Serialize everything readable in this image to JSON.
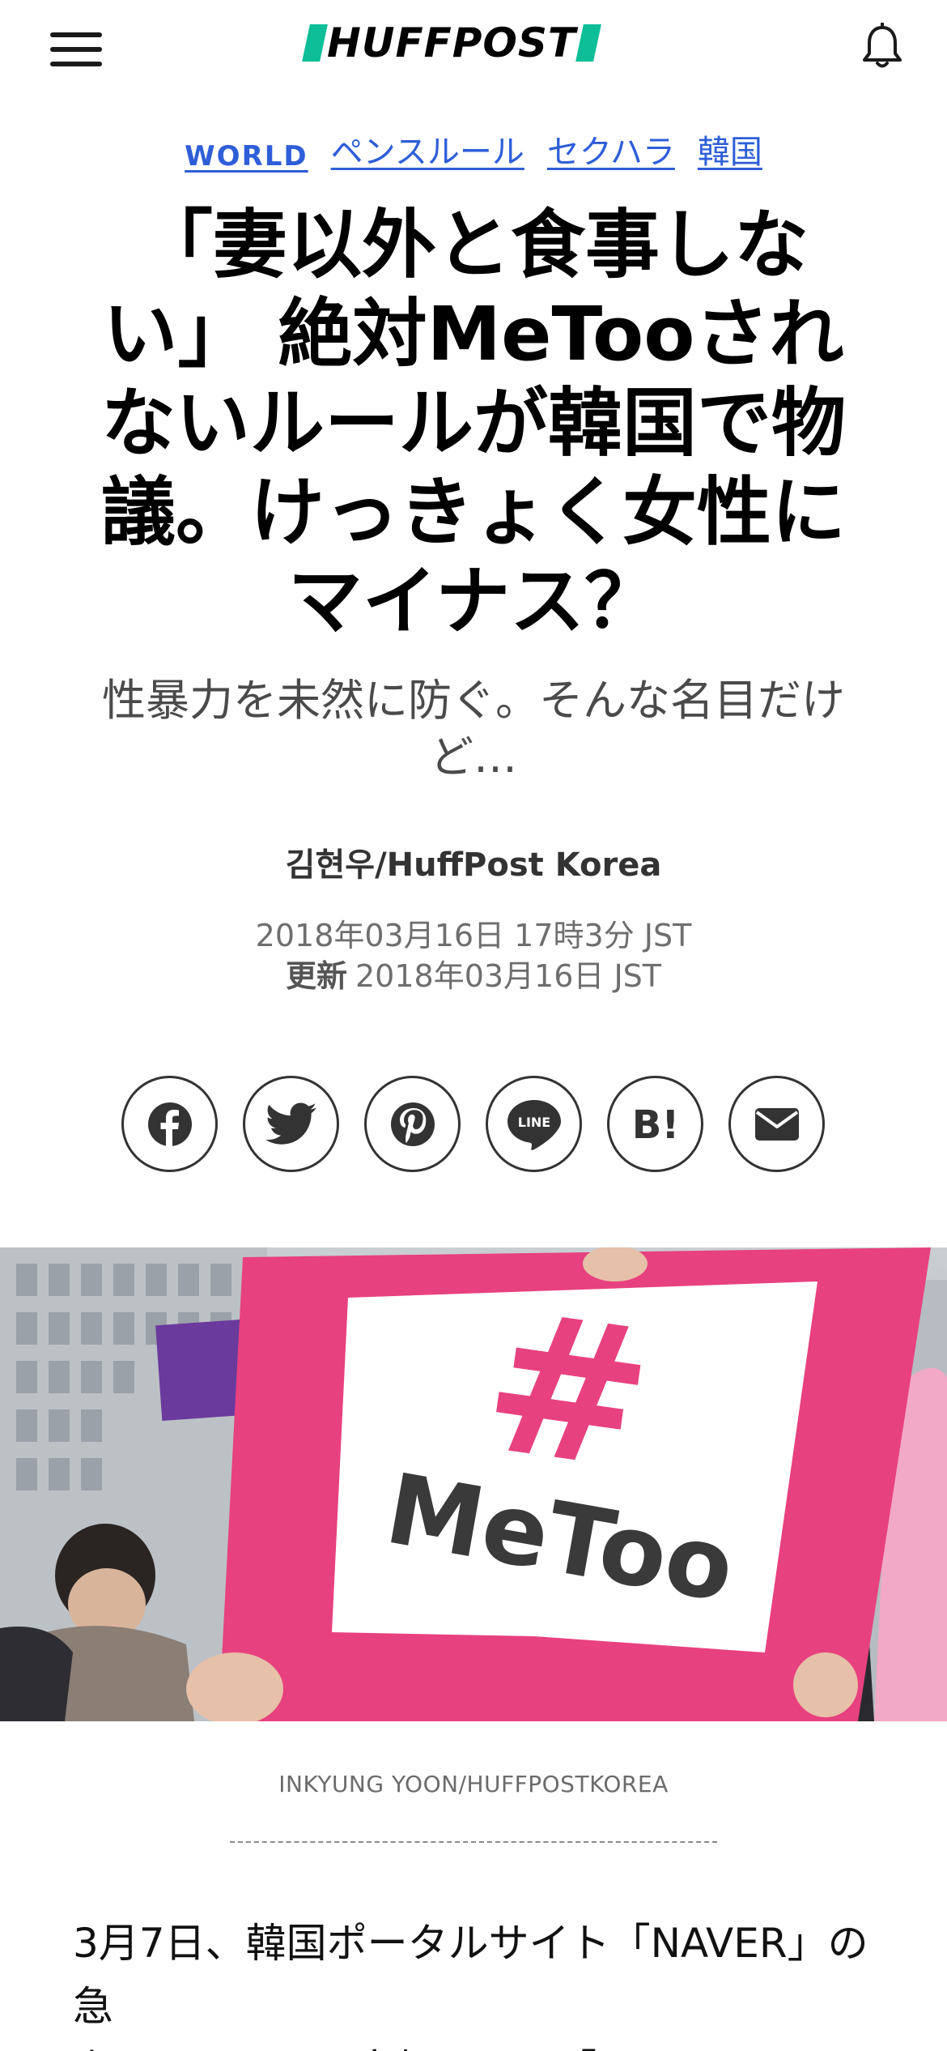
{
  "header": {
    "logo_text": "HUFFPOST",
    "menu_icon": "hamburger-menu-icon",
    "bell_icon": "bell-icon"
  },
  "tags": [
    "WORLD",
    "ペンスルール",
    "セクハラ",
    "韓国"
  ],
  "article": {
    "headline": "「妻以外と食事しない」 絶対MeTooされないルールが韓国で物議。けっきょく女性にマイナス？",
    "subhead": "性暴力を未然に防ぐ。そんな名目だけど…",
    "byline": "김현우/HuffPost Korea",
    "published": "2018年03月16日 17時3分 JST",
    "updated_label": "更新",
    "updated": "2018年03月16日 JST",
    "image_caption": "INKYUNG YOON/HUFFPOSTKOREA",
    "image_sign_hash": "#",
    "image_sign_text": "MeToo",
    "body_lines": [
      "3月7日、韓国ポータルサイト「NAVER」の急",
      "上昇ワードに、突如として「ペンスルール」"
    ]
  },
  "share": [
    {
      "icon": "facebook-icon"
    },
    {
      "icon": "twitter-icon"
    },
    {
      "icon": "pinterest-icon"
    },
    {
      "icon": "line-icon",
      "label": "LINE"
    },
    {
      "icon": "hatena-bookmark-icon",
      "label": "B!"
    },
    {
      "icon": "email-icon"
    }
  ],
  "colors": {
    "accent_link": "#2e5ed8",
    "logo_green": "#0dbe98",
    "sign_pink": "#e8417f"
  }
}
